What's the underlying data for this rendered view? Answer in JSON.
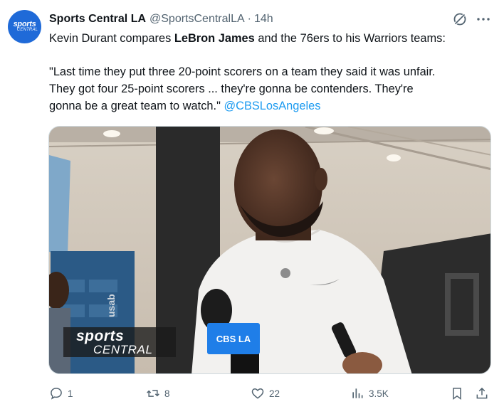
{
  "account": {
    "avatar_text_top": "sports",
    "avatar_text_bottom": "CENTRAL",
    "display_name": "Sports Central LA",
    "handle": "@SportsCentralLA",
    "separator": "·",
    "time": "14h"
  },
  "tweet": {
    "line1_pre": "Kevin Durant compares ",
    "line1_bold": "LeBron James",
    "line1_post": " and the 76ers to his Warriors teams:",
    "quote_line1": "\"Last time they put three 20-point scorers on a team they said it was unfair.",
    "quote_line2": "They got four 25-point scorers ... they're gonna be contenders. They're",
    "quote_line3_pre": "gonna be a great team to watch.\" ",
    "mention": "@CBSLosAngeles"
  },
  "media": {
    "watermark_top": "sports",
    "watermark_bottom": "CENTRAL",
    "mic_flag": "CBS LA",
    "backdrop_text": "usab"
  },
  "actions": {
    "replies": "1",
    "reposts": "8",
    "likes": "22",
    "views": "3.5K"
  },
  "colors": {
    "link": "#1d9bf0",
    "text": "#0f1419",
    "muted": "#536471",
    "avatar_bg": "#1f6ad8"
  },
  "icons": [
    "grok-icon",
    "more-icon",
    "reply-icon",
    "repost-icon",
    "like-icon",
    "views-icon",
    "bookmark-icon",
    "share-icon"
  ]
}
